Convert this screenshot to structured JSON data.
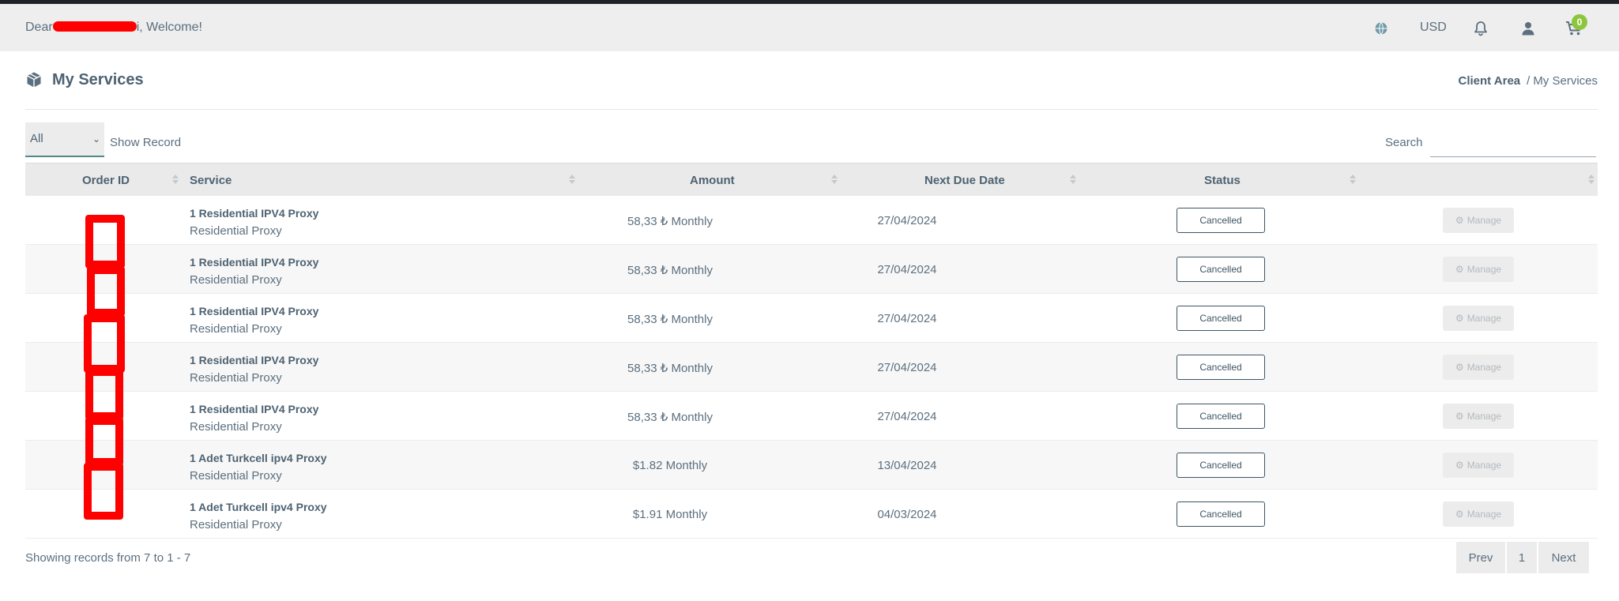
{
  "header": {
    "welcome_prefix": "Dear",
    "welcome_suffix": "i, Welcome!",
    "currency": "USD",
    "cart_count": "0"
  },
  "page": {
    "title": "My Services",
    "breadcrumb_home": "Client Area",
    "breadcrumb_sep": "/",
    "breadcrumb_current": "My Services"
  },
  "filter": {
    "selected": "All",
    "show_record_label": "Show Record"
  },
  "search": {
    "label": "Search",
    "value": ""
  },
  "table": {
    "columns": [
      "Order ID",
      "Service",
      "Amount",
      "Next Due Date",
      "Status"
    ],
    "manage_label": "Manage",
    "rows": [
      {
        "service": "1 Residential IPV4 Proxy",
        "group": "Residential Proxy",
        "amount": "58,33 ₺ Monthly",
        "due": "27/04/2024",
        "status": "Cancelled"
      },
      {
        "service": "1 Residential IPV4 Proxy",
        "group": "Residential Proxy",
        "amount": "58,33 ₺ Monthly",
        "due": "27/04/2024",
        "status": "Cancelled"
      },
      {
        "service": "1 Residential IPV4 Proxy",
        "group": "Residential Proxy",
        "amount": "58,33 ₺ Monthly",
        "due": "27/04/2024",
        "status": "Cancelled"
      },
      {
        "service": "1 Residential IPV4 Proxy",
        "group": "Residential Proxy",
        "amount": "58,33 ₺ Monthly",
        "due": "27/04/2024",
        "status": "Cancelled"
      },
      {
        "service": "1 Residential IPV4 Proxy",
        "group": "Residential Proxy",
        "amount": "58,33 ₺ Monthly",
        "due": "27/04/2024",
        "status": "Cancelled"
      },
      {
        "service": "1 Adet Turkcell ipv4 Proxy",
        "group": "Residential Proxy",
        "amount": "$1.82 Monthly",
        "due": "13/04/2024",
        "status": "Cancelled"
      },
      {
        "service": "1 Adet Turkcell ipv4 Proxy",
        "group": "Residential Proxy",
        "amount": "$1.91 Monthly",
        "due": "04/03/2024",
        "status": "Cancelled"
      }
    ]
  },
  "footer": {
    "records_info": "Showing records from 7 to 1 - 7",
    "prev_label": "Prev",
    "page_number": "1",
    "next_label": "Next"
  },
  "colors": {
    "accent": "#4f8a8b",
    "badge": "#8cc63f",
    "redaction": "#ff0000"
  }
}
